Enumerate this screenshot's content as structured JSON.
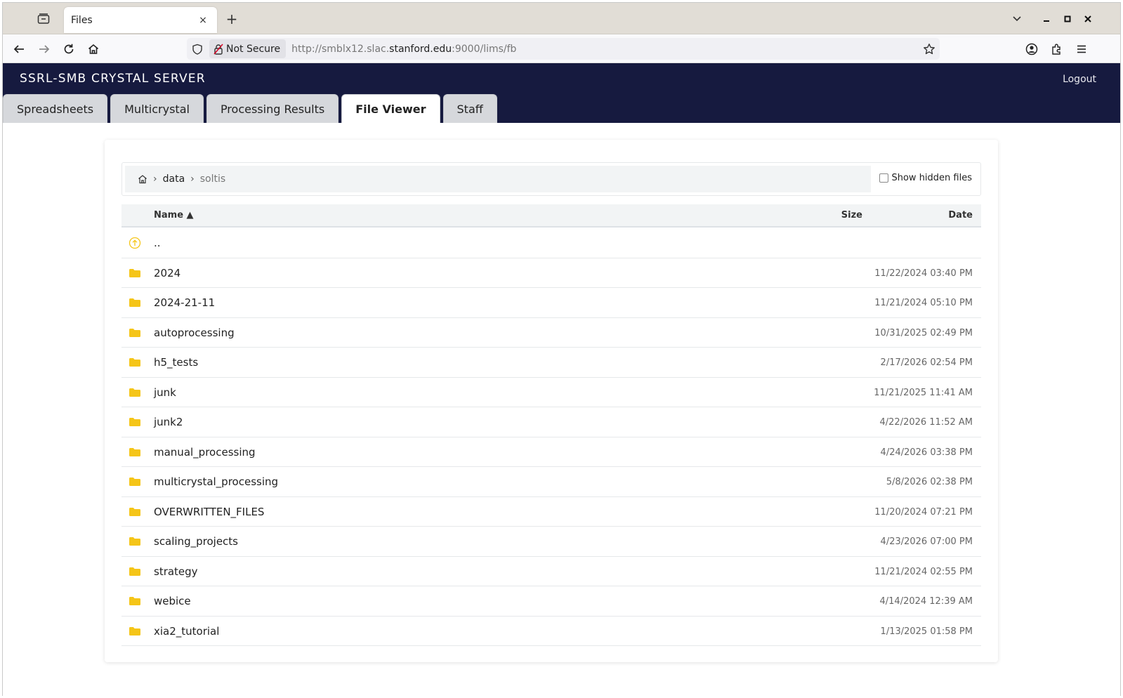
{
  "browser": {
    "tab_title": "Files",
    "tab_close": "×",
    "new_tab": "+",
    "url_security": "Not Secure",
    "url_prefix": "http://smblx12.slac.",
    "url_host": "stanford.edu",
    "url_suffix": ":9000/lims/fb",
    "icons": [
      "tab-overview-icon",
      "chevron-down-icon",
      "minimize-icon",
      "maximize-icon",
      "close-icon",
      "back-icon",
      "forward-icon",
      "reload-icon",
      "home-icon",
      "shield-icon",
      "insecure-lock-icon",
      "star-icon",
      "account-icon",
      "extensions-icon",
      "menu-icon"
    ]
  },
  "app": {
    "title": "SSRL-SMB CRYSTAL SERVER",
    "logout": "Logout",
    "tabs": [
      {
        "label": "Spreadsheets",
        "active": false
      },
      {
        "label": "Multicrystal",
        "active": false
      },
      {
        "label": "Processing Results",
        "active": false
      },
      {
        "label": "File Viewer",
        "active": true
      },
      {
        "label": "Staff",
        "active": false
      }
    ],
    "header_color": "#161a3f"
  },
  "file_viewer": {
    "breadcrumb": {
      "sep": "›",
      "items": [
        "data",
        "soltis"
      ]
    },
    "show_hidden_label": "Show hidden files",
    "show_hidden_checked": false,
    "columns": {
      "name": "Name ▲",
      "size": "Size",
      "date": "Date"
    },
    "folder_color": "#f5c518",
    "rows": [
      {
        "name": "..",
        "date": "",
        "type": "parent"
      },
      {
        "name": "2024",
        "date": "11/22/2024 03:40 PM",
        "type": "folder"
      },
      {
        "name": "2024-21-11",
        "date": "11/21/2024 05:10 PM",
        "type": "folder"
      },
      {
        "name": "autoprocessing",
        "date": "10/31/2025 02:49 PM",
        "type": "folder"
      },
      {
        "name": "h5_tests",
        "date": "2/17/2026 02:54 PM",
        "type": "folder"
      },
      {
        "name": "junk",
        "date": "11/21/2025 11:41 AM",
        "type": "folder"
      },
      {
        "name": "junk2",
        "date": "4/22/2026 11:52 AM",
        "type": "folder"
      },
      {
        "name": "manual_processing",
        "date": "4/24/2026 03:38 PM",
        "type": "folder"
      },
      {
        "name": "multicrystal_processing",
        "date": "5/8/2026 02:38 PM",
        "type": "folder"
      },
      {
        "name": "OVERWRITTEN_FILES",
        "date": "11/20/2024 07:21 PM",
        "type": "folder"
      },
      {
        "name": "scaling_projects",
        "date": "4/23/2026 07:00 PM",
        "type": "folder"
      },
      {
        "name": "strategy",
        "date": "11/21/2024 02:55 PM",
        "type": "folder"
      },
      {
        "name": "webice",
        "date": "4/14/2024 12:39 AM",
        "type": "folder"
      },
      {
        "name": "xia2_tutorial",
        "date": "1/13/2025 01:58 PM",
        "type": "folder"
      }
    ]
  }
}
